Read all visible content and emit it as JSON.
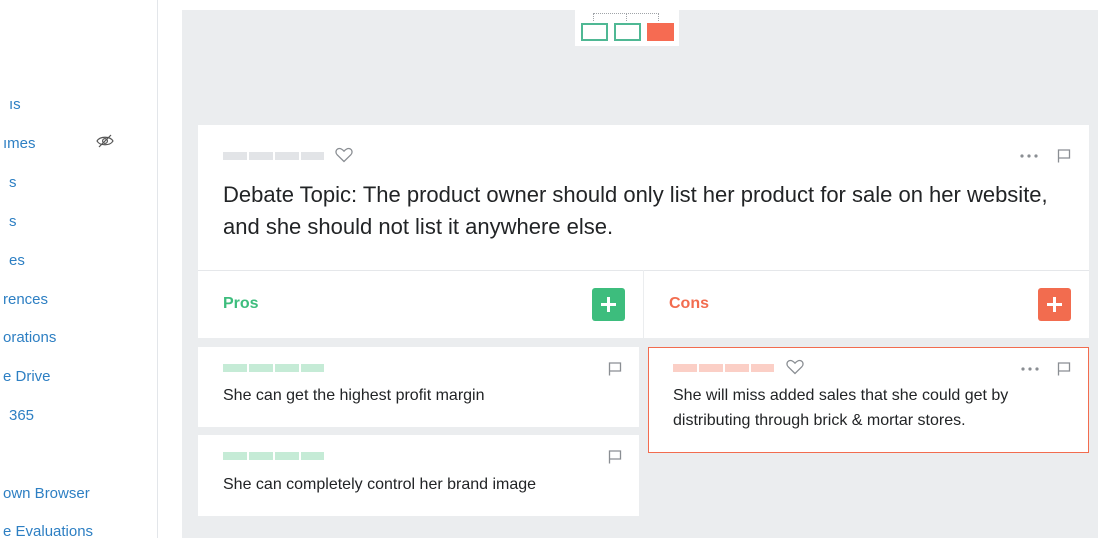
{
  "sidebar": {
    "items": [
      {
        "label": "ıs"
      },
      {
        "label": "ımes"
      },
      {
        "label": "s"
      },
      {
        "label": "s"
      },
      {
        "label": "es"
      },
      {
        "label": "rences"
      },
      {
        "label": "orations"
      },
      {
        "label": "e Drive"
      },
      {
        "label": "365"
      },
      {
        "label": ""
      },
      {
        "label": "own Browser"
      },
      {
        "label": "e Evaluations"
      }
    ],
    "hidden_icon": "eye-slash-icon"
  },
  "layout_switch": {
    "options": [
      "layout-option-1",
      "layout-option-2",
      "layout-option-3"
    ],
    "active_index": 2
  },
  "topic": {
    "text": "Debate Topic: The product owner should only list her product for sale on her website, and she should not list it anywhere else."
  },
  "pros": {
    "title": "Pros",
    "color": "#3dbd7d",
    "items": [
      {
        "text": "She can get the highest profit margin"
      },
      {
        "text": "She can completely control her brand image"
      }
    ]
  },
  "cons": {
    "title": "Cons",
    "color": "#f26c4f",
    "items": [
      {
        "text": "She will miss added sales that she could get by distributing through brick & mortar stores."
      }
    ]
  },
  "colors": {
    "background": "#ebedef",
    "link": "#2d7fc3",
    "accent_active": "#f66b52",
    "layout_outline": "#4fb894"
  }
}
